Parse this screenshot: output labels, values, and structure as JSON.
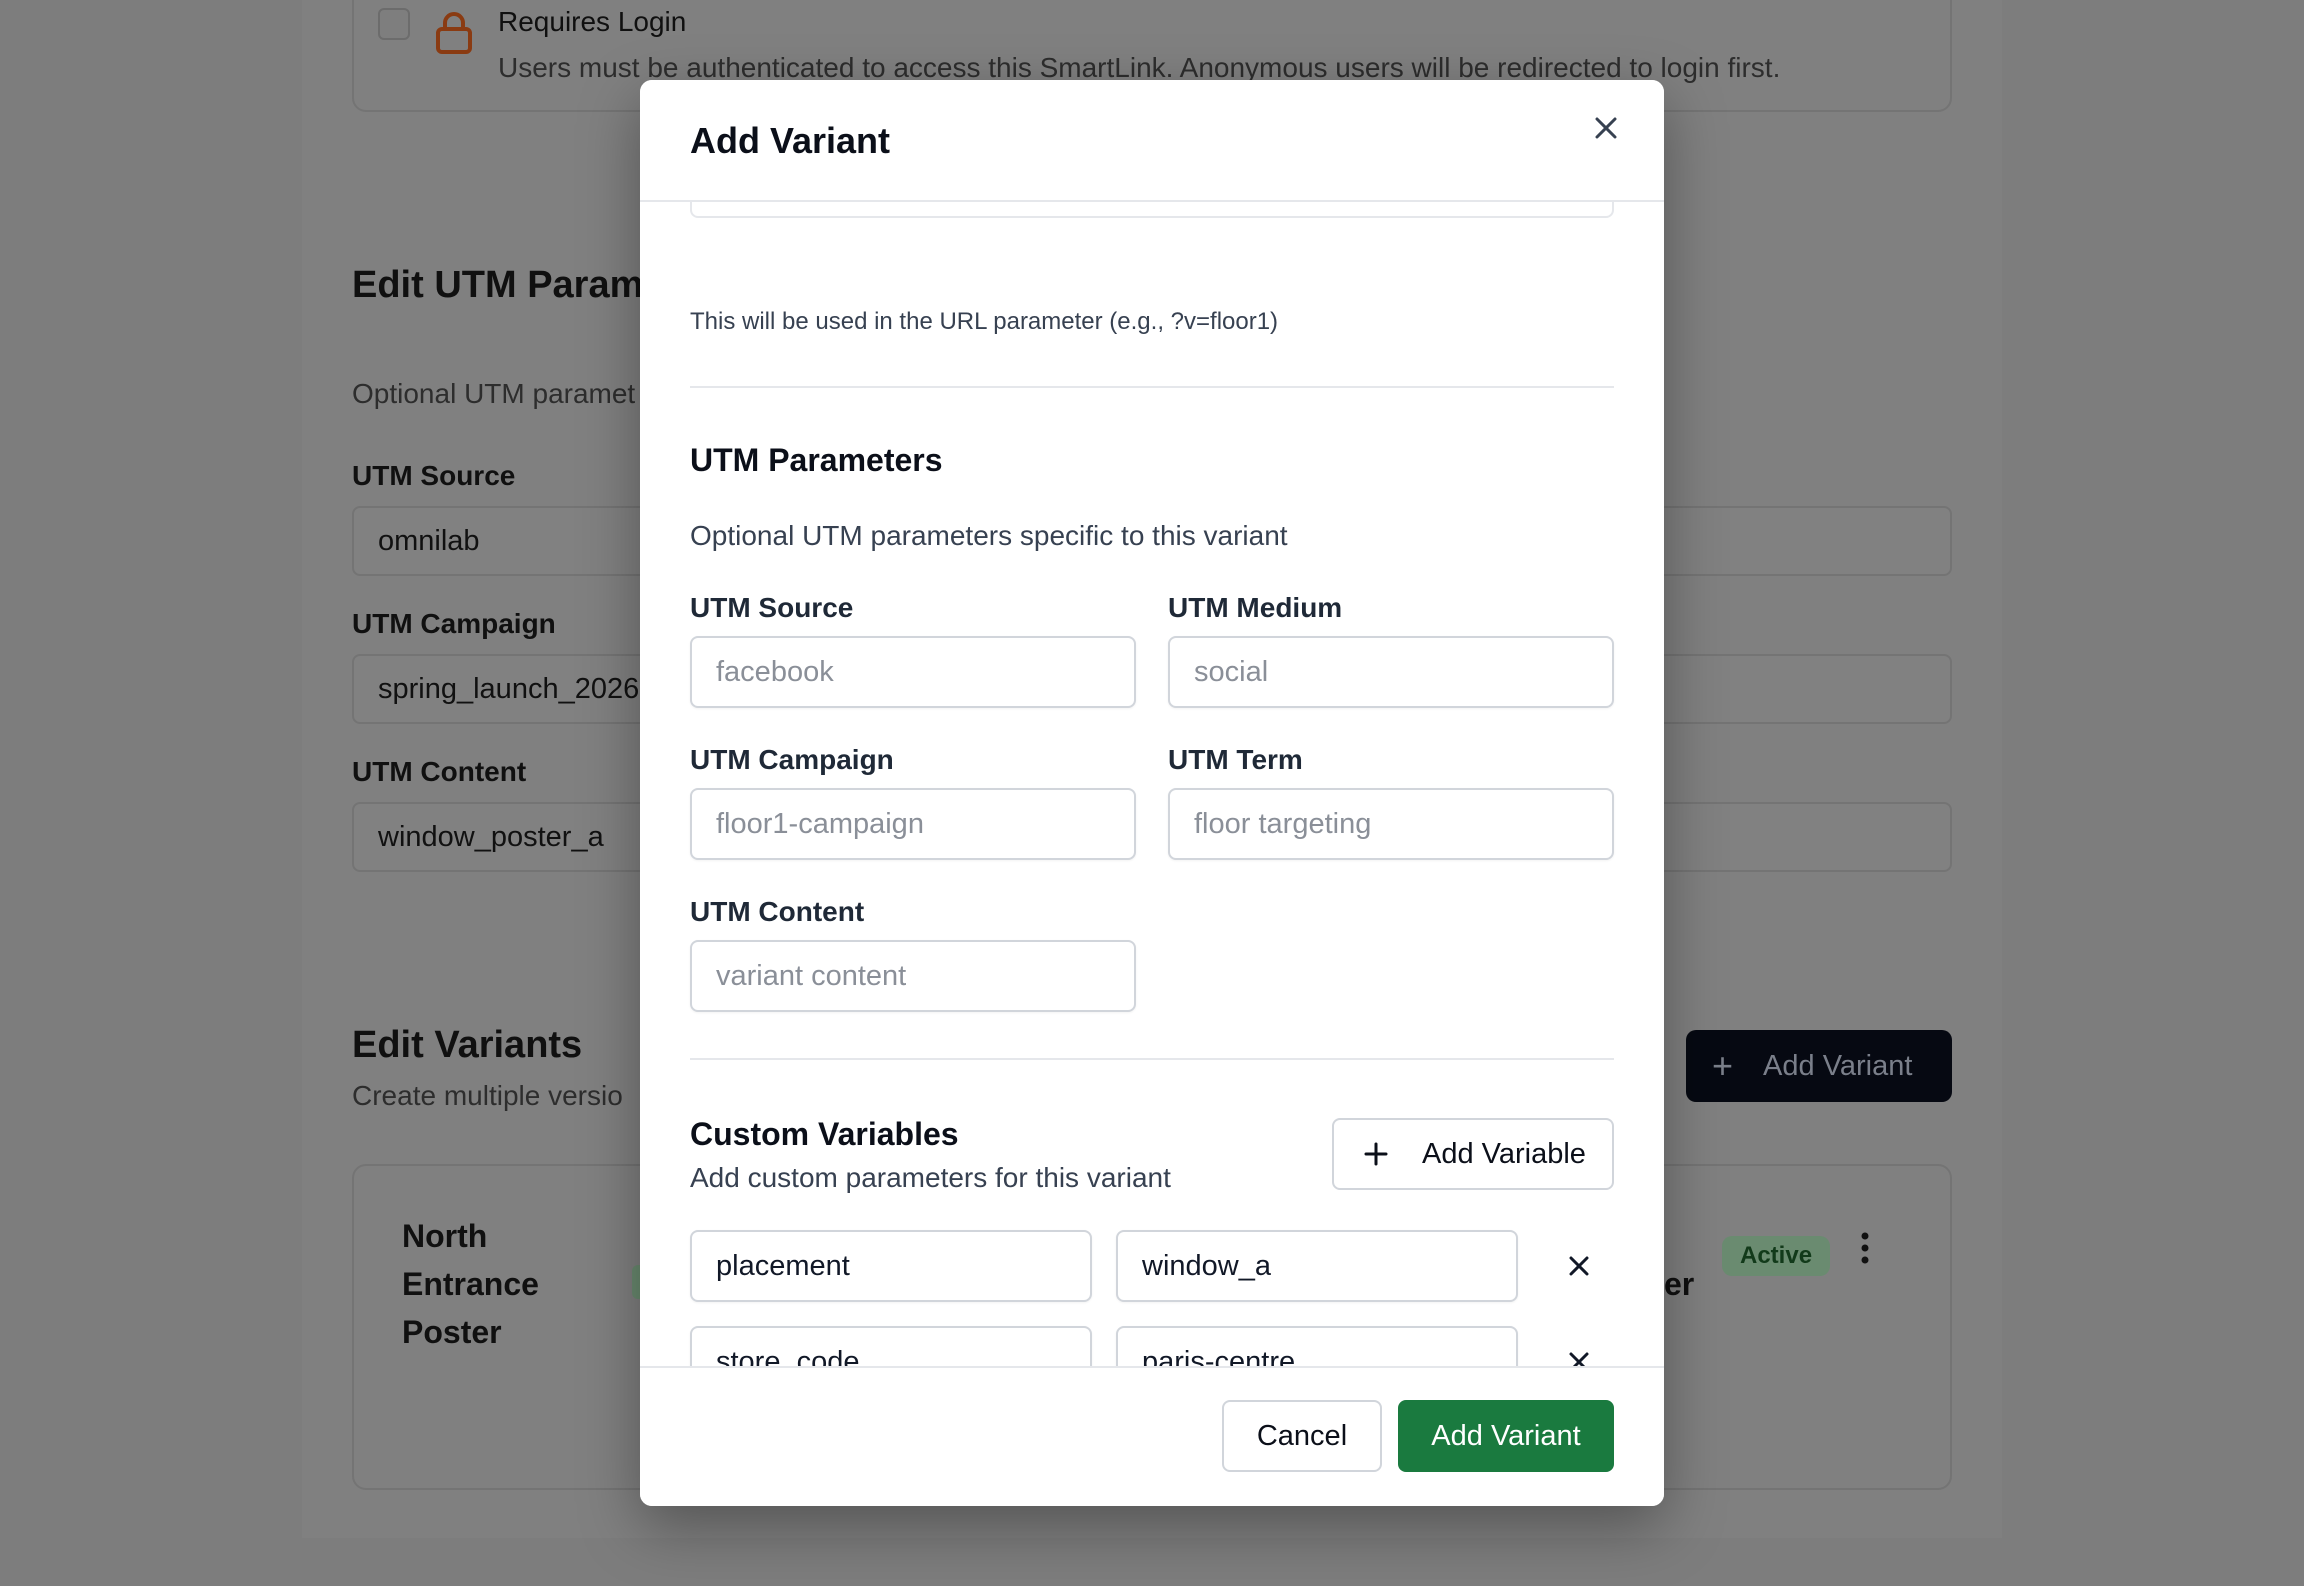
{
  "background": {
    "requires_login": {
      "title": "Requires Login",
      "description": "Users must be authenticated to access this SmartLink. Anonymous users will be redirected to login first."
    },
    "utm_section": {
      "title": "Edit UTM Parame",
      "subtitle": "Optional UTM paramet",
      "source_label": "UTM Source",
      "source_value": "omnilab",
      "campaign_label": "UTM Campaign",
      "campaign_value": "spring_launch_2026",
      "content_label": "UTM Content",
      "content_value": "window_poster_a"
    },
    "variants_section": {
      "title": "Edit Variants",
      "subtitle": "Create multiple versio",
      "add_button": "Add Variant",
      "variant_name": [
        "North",
        "Entrance",
        "Poster"
      ],
      "right_fragment": "er",
      "status_badge": "Active"
    }
  },
  "modal": {
    "title": "Add Variant",
    "slug_hint": "This will be used in the URL parameter (e.g., ?v=floor1)",
    "utm": {
      "title": "UTM Parameters",
      "subtitle": "Optional UTM parameters specific to this variant",
      "source_label": "UTM Source",
      "source_placeholder": "facebook",
      "medium_label": "UTM Medium",
      "medium_placeholder": "social",
      "campaign_label": "UTM Campaign",
      "campaign_placeholder": "floor1-campaign",
      "term_label": "UTM Term",
      "term_placeholder": "floor targeting",
      "content_label": "UTM Content",
      "content_placeholder": "variant content"
    },
    "custom_vars": {
      "title": "Custom Variables",
      "subtitle": "Add custom parameters for this variant",
      "add_button": "Add Variable",
      "rows": [
        {
          "key": "placement",
          "value": "window_a"
        },
        {
          "key": "store_code",
          "value": "paris-centre"
        }
      ]
    },
    "footer": {
      "cancel": "Cancel",
      "submit": "Add Variant"
    }
  },
  "colors": {
    "primary_green": "#1a7a3f",
    "dark_button": "#060912",
    "lock_orange": "#c2410c"
  }
}
